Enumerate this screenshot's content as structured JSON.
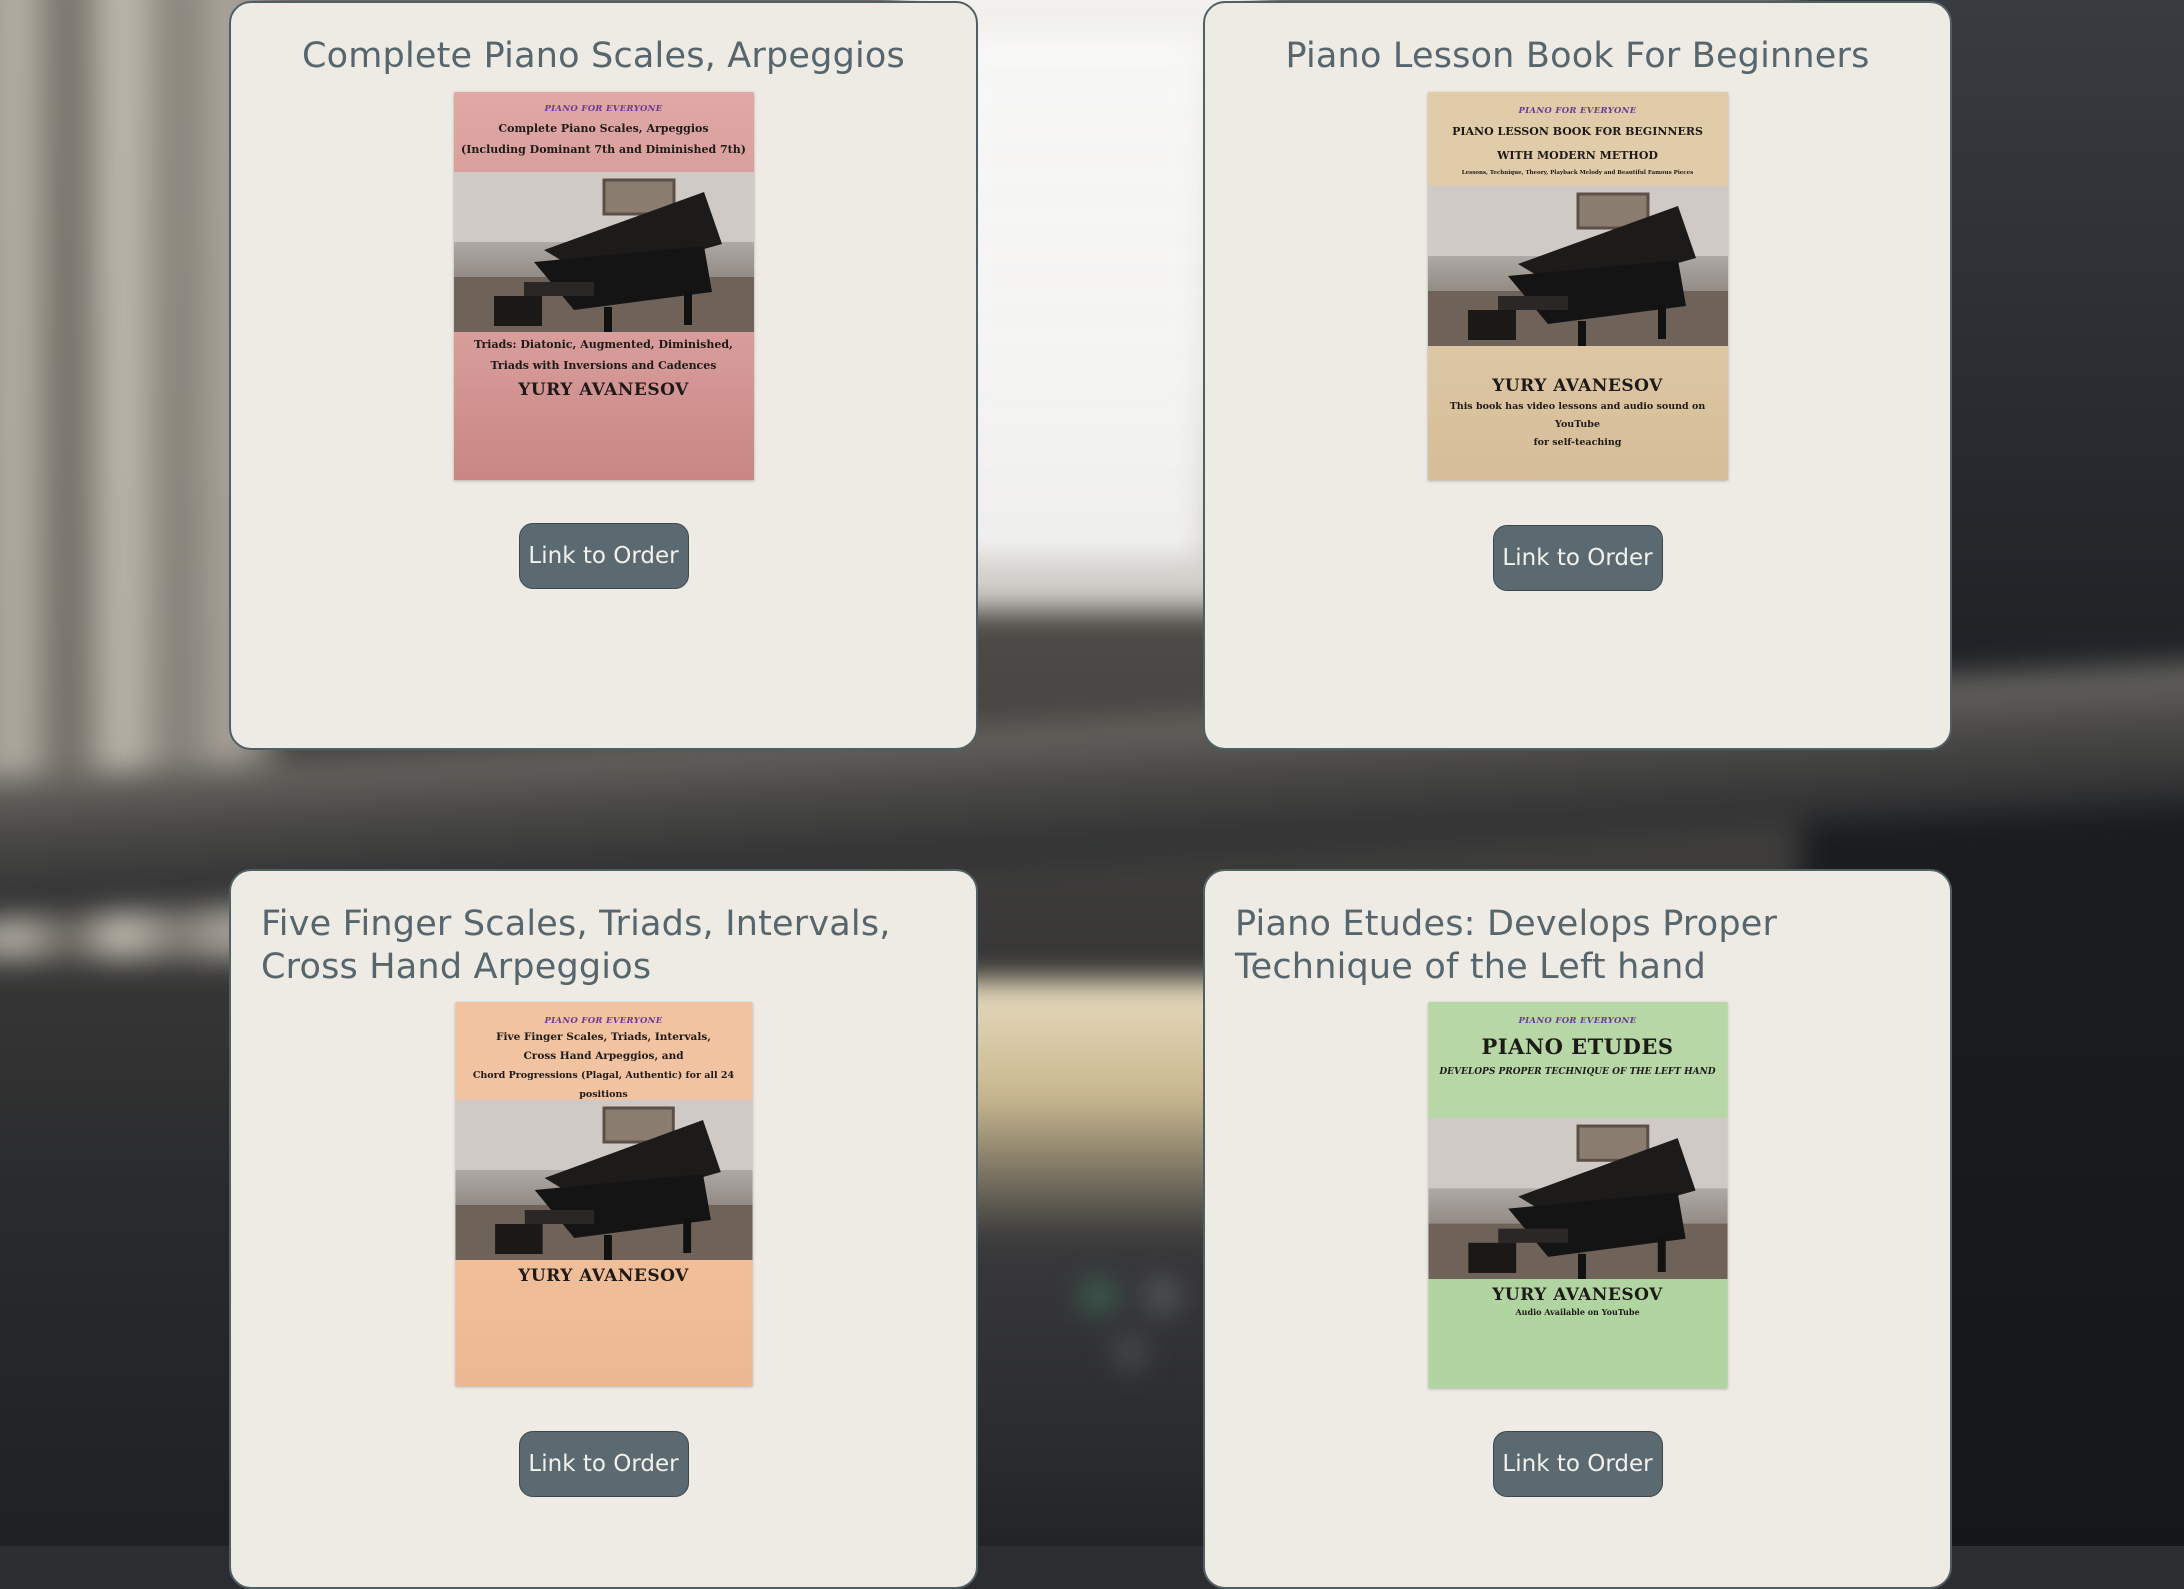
{
  "cards": [
    {
      "title": "Complete Piano Scales, Arpeggios",
      "button": "Link to Order",
      "cover": {
        "series": "PIANO FOR EVERYONE",
        "lines_top": [
          "Complete Piano Scales, Arpeggios",
          "(Including Dominant 7th and Diminished 7th)"
        ],
        "lines_bottom": [
          "Triads: Diatonic, Augmented, Diminished,",
          "Triads with Inversions and Cadences"
        ],
        "author": "YURY AVANESOV",
        "color": "#d69a98"
      }
    },
    {
      "title": "Piano Lesson Book For Beginners",
      "button": "Link to Order",
      "cover": {
        "series": "PIANO FOR EVERYONE",
        "lines_top": [
          "PIANO LESSON BOOK FOR BEGINNERS",
          "WITH MODERN METHOD",
          "Lessons, Technique, Theory, Playback Melody and Beautiful Famous Pieces"
        ],
        "author": "YURY AVANESOV",
        "lines_bottom": [
          "This book has video lessons and audio sound on YouTube",
          "for self-teaching"
        ],
        "color": "#dcc6a4"
      }
    },
    {
      "title": "Five Finger Scales, Triads, Intervals, Cross Hand Arpeggios",
      "button": "Link to Order",
      "cover": {
        "series": "PIANO FOR EVERYONE",
        "lines_top": [
          "Five Finger Scales, Triads, Intervals,",
          "Cross Hand Arpeggios, and",
          "Chord Progressions (Plagal, Authentic) for all 24 positions"
        ],
        "author": "YURY AVANESOV",
        "color": "#f1c09c"
      }
    },
    {
      "title": "Piano Etudes: Develops Proper Technique of the Left hand",
      "button": "Link to Order",
      "cover": {
        "series": "PIANO FOR EVERYONE",
        "big_title": "PIANO ETUDES",
        "subtitle": "DEVELOPS PROPER TECHNIQUE OF THE LEFT HAND",
        "author": "YURY AVANESOV",
        "lines_bottom": [
          "Audio Available on YouTube"
        ],
        "color": "#b2d6a2"
      }
    }
  ]
}
